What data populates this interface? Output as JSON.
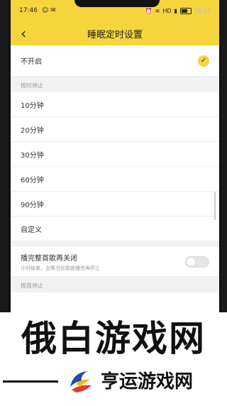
{
  "status": {
    "time": "17:46",
    "right_text": "HD",
    "right_time": "16:30"
  },
  "appbar": {
    "back_icon": "‹",
    "title": "睡眠定时设置"
  },
  "off_row": {
    "label": "不开启"
  },
  "timer_section": {
    "title": "按时停止"
  },
  "timer_options": [
    "10分钟",
    "20分钟",
    "30分钟",
    "60分钟",
    "90分钟",
    "自定义"
  ],
  "finish_song": {
    "label": "播完整首歌再关闭",
    "desc": "计时结束，会等当前歌曲播完再停止"
  },
  "song_section": {
    "title": "按首停止"
  },
  "watermark": {
    "top": "俄白游戏网",
    "bottom": "亨运游戏网"
  },
  "colors": {
    "accent": "#f6d43c"
  }
}
